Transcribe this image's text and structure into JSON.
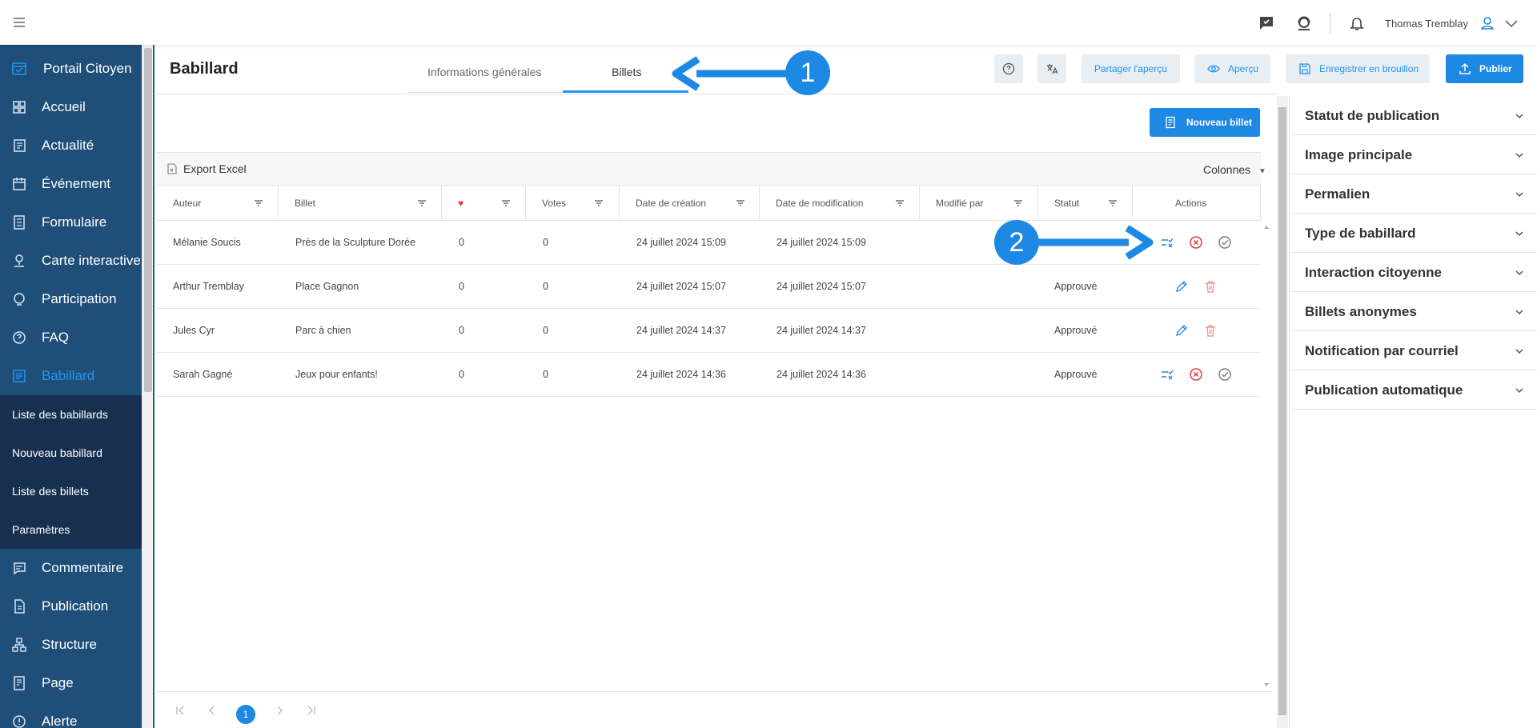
{
  "topbar": {
    "user_name": "Thomas Tremblay"
  },
  "sidebar": {
    "portal_label": "Portail Citoyen",
    "items": [
      {
        "label": "Accueil",
        "icon": "dashboard-icon"
      },
      {
        "label": "Actualité",
        "icon": "news-icon"
      },
      {
        "label": "Événement",
        "icon": "calendar-icon"
      },
      {
        "label": "Formulaire",
        "icon": "form-icon"
      },
      {
        "label": "Carte interactive",
        "icon": "map-pin-icon"
      },
      {
        "label": "Participation",
        "icon": "participation-icon"
      },
      {
        "label": "FAQ",
        "icon": "help-icon"
      },
      {
        "label": "Babillard",
        "icon": "board-icon",
        "active": true
      }
    ],
    "sub_items": [
      "Liste des babillards",
      "Nouveau babillard",
      "Liste des billets",
      "Paramètres"
    ],
    "items_after": [
      {
        "label": "Commentaire",
        "icon": "comment-icon"
      },
      {
        "label": "Publication",
        "icon": "document-icon"
      },
      {
        "label": "Structure",
        "icon": "structure-icon"
      },
      {
        "label": "Page",
        "icon": "page-icon"
      },
      {
        "label": "Alerte",
        "icon": "alert-icon"
      }
    ],
    "active_color": "#2196f3",
    "background_color": "#1f4e79"
  },
  "header": {
    "title": "Babillard",
    "tabs": [
      {
        "label": "Informations générales",
        "active": false
      },
      {
        "label": "Billets",
        "active": true
      }
    ],
    "share_label": "Partager l'aperçu",
    "preview_label": "Aperçu",
    "save_draft_label": "Enregistrer en brouillon",
    "publish_label": "Publier"
  },
  "grid": {
    "new_ticket_label": "Nouveau billet",
    "export_label": "Export Excel",
    "columns_label": "Colonnes",
    "columns": [
      "Auteur",
      "Billet",
      "♥",
      "Votes",
      "Date de création",
      "Date de modification",
      "Modifié par",
      "Statut",
      "Actions"
    ],
    "rows": [
      {
        "author": "Mélanie Soucis",
        "ticket": "Près de la Sculpture Dorée",
        "likes": "0",
        "votes": "0",
        "created": "24 juillet 2024 15:09",
        "modified": "24 juillet 2024 15:09",
        "modified_by": "",
        "status": "",
        "actions": "moderate"
      },
      {
        "author": "Arthur Tremblay",
        "ticket": "Place Gagnon",
        "likes": "0",
        "votes": "0",
        "created": "24 juillet 2024 15:07",
        "modified": "24 juillet 2024 15:07",
        "modified_by": "",
        "status": "Approuvé",
        "actions": "edit"
      },
      {
        "author": "Jules Cyr",
        "ticket": "Parc à chien",
        "likes": "0",
        "votes": "0",
        "created": "24 juillet 2024 14:37",
        "modified": "24 juillet 2024 14:37",
        "modified_by": "",
        "status": "Approuvé",
        "actions": "edit"
      },
      {
        "author": "Sarah Gagné",
        "ticket": "Jeux pour enfants!",
        "likes": "0",
        "votes": "0",
        "created": "24 juillet 2024 14:36",
        "modified": "24 juillet 2024 14:36",
        "modified_by": "",
        "status": "Approuvé",
        "actions": "moderate"
      }
    ],
    "current_page": "1"
  },
  "right_panel": {
    "sections": [
      "Statut de publication",
      "Image principale",
      "Permalien",
      "Type de babillard",
      "Interaction citoyenne",
      "Billets anonymes",
      "Notification par courriel",
      "Publication automatique"
    ]
  },
  "callouts": [
    "1",
    "2"
  ],
  "colors": {
    "accent": "#1e88e5",
    "heart": "#e53935",
    "reject": "#e53935",
    "delete": "#ef9a9a"
  }
}
